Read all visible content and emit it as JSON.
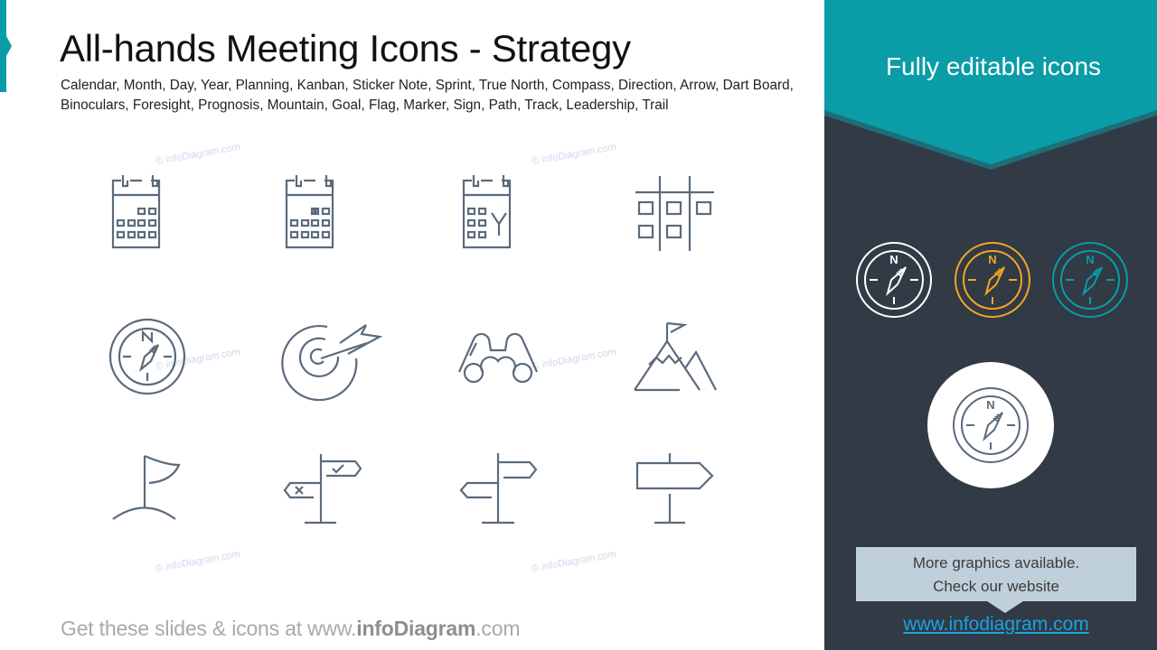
{
  "slide": {
    "title": "All-hands Meeting Icons - Strategy",
    "subtitle": "Calendar, Month, Day, Year, Planning, Kanban, Sticker Note, Sprint, True North, Compass, Direction, Arrow, Dart Board, Binoculars, Foresight, Prognosis, Mountain, Goal, Flag, Marker, Sign, Path, Track, Leadership, Trail",
    "watermark": "© infoDiagram.com",
    "footer": {
      "prefix": "Get these slides & icons at www.",
      "brand": "infoDiagram",
      "suffix": ".com"
    },
    "icons": [
      {
        "name": "calendar-month-icon"
      },
      {
        "name": "calendar-day-icon"
      },
      {
        "name": "calendar-year-icon",
        "letter": "Y"
      },
      {
        "name": "kanban-board-icon"
      },
      {
        "name": "compass-icon",
        "letter": "N"
      },
      {
        "name": "dart-board-icon"
      },
      {
        "name": "binoculars-icon"
      },
      {
        "name": "mountain-flag-icon"
      },
      {
        "name": "flag-marker-icon"
      },
      {
        "name": "direction-sign-check-cross-icon"
      },
      {
        "name": "direction-signpost-icon"
      },
      {
        "name": "sign-board-icon"
      }
    ]
  },
  "panel": {
    "title": "Fully editable icons",
    "compass_letter": "N",
    "variants": [
      {
        "name": "white",
        "color": "#ffffff"
      },
      {
        "name": "orange",
        "color": "#f0a725"
      },
      {
        "name": "teal",
        "color": "#0a9ca7"
      }
    ],
    "highlight_color": "#5b6b7c",
    "callout": {
      "line1": "More graphics available.",
      "line2": "Check our website"
    },
    "link": "www.infodiagram.com"
  },
  "colors": {
    "accent": "#0a9ca7",
    "panel_bg": "#313a45",
    "icon_stroke": "#5b6b7c",
    "callout_bg": "#c0d0da",
    "link": "#1aa3e0"
  }
}
